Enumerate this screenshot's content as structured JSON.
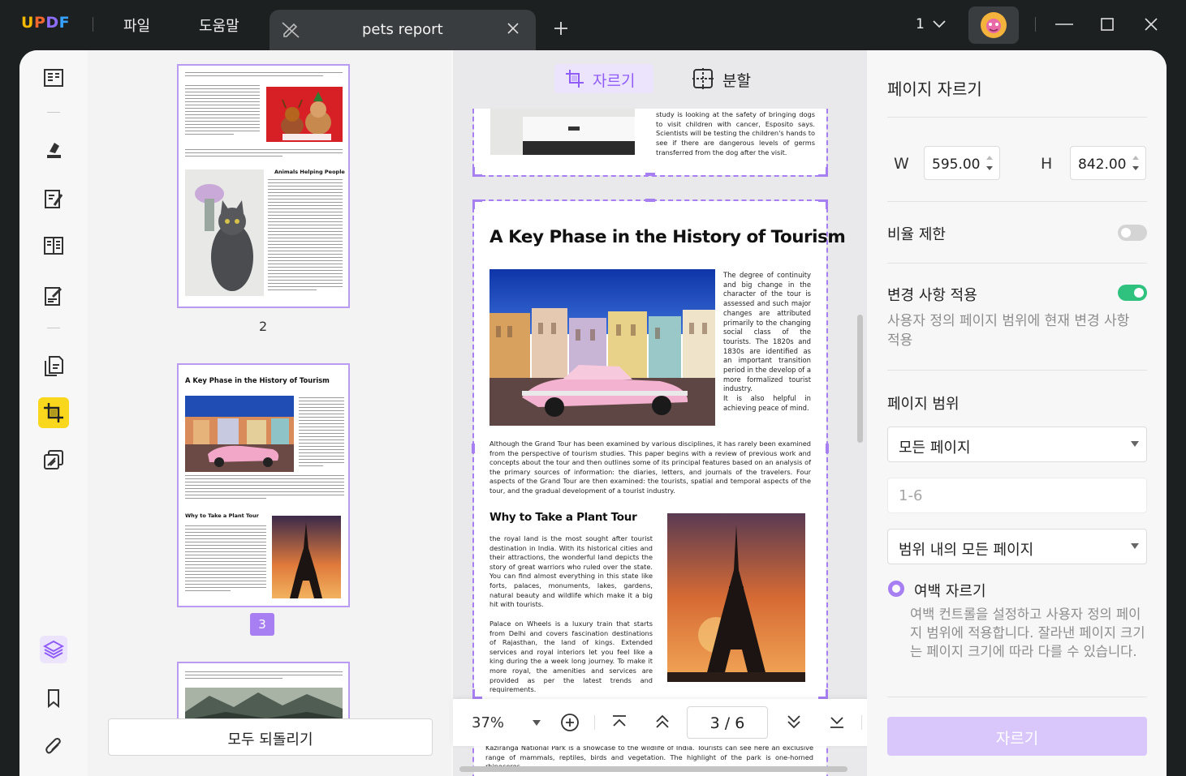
{
  "app": {
    "logo": "UPDF",
    "menu": [
      "파일",
      "도움말"
    ],
    "tab_title": "pets report",
    "page_indicator": "1",
    "brand_colors": {
      "u": "#f5b800",
      "p": "#f0662f",
      "d": "#8d6dfa",
      "f": "#36a2ff"
    }
  },
  "toolbar": {
    "crop_label": "자르기",
    "split_label": "분할"
  },
  "thumbnails": {
    "page2_number": "2",
    "page3_number": "3",
    "page2": {
      "intro": "Pet's Bodies…",
      "heading": "Animals Helping People"
    },
    "page3": {
      "title": "A Key Phase in the History of Tourism",
      "heading": "Why to Take a Plant Tour"
    },
    "page4": {
      "intro": "Kaziranga National Park is a showcase to the wildlife of India."
    },
    "revert_all_label": "모두 되돌리기"
  },
  "preview": {
    "prev_page_text": "study is looking at the safety of bringing dogs to visit children with cancer, Esposito says. Scientists will be testing the children's hands to see if there are dangerous levels of germs transferred from the dog after the visit.",
    "title": "A Key Phase in the History of Tourism",
    "side_text": "The degree of continuity and big change in the character of the tour is assessed and such major changes are attributed primarily to the changing social class of the tourists. The 1820s and 1830s are identified as an important transition period in the develop of a more formalized tourist industry.",
    "side_text2": "It is also helpful in achieving peace of mind.",
    "para1": "Although the Grand Tour has been examined by various disciplines, it has rarely been examined from the perspective of tourism studies. This paper begins with a review of previous work and concepts about the tour and then outlines some of its principal features based on an analysis of the primary sources of information: the diaries, letters, and journals of the travelers. Four aspects of the Grand Tour are then examined: the tourists, spatial and temporal aspects of the tour, and the gradual development of a tourist industry.",
    "heading2": "Why to Take a Plant Tour",
    "para2": "the royal land is the most sought after tourist destination in India. With its historical cities and their attractions, the wonderful land depicts the story of great warriors who ruled over the state. You can find almost everything in this state like forts, palaces, monuments, lakes, gardens, natural beauty and wildlife which make it a big hit with tourists.",
    "para3": "Palace on Wheels is a luxury train that starts from Delhi and covers fascination destinations of Rajasthan, the land of kings. Extended services and royal interiors let you feel like a king during the a week long journey. To make it more royal, the amenities and services are provided as per the latest trends and requirements.",
    "next_page_text": "Kaziranga National Park is a showcase to the wildlife of India. Tourists can see here an exclusive range of mammals, reptiles, birds and vegetation. The highlight of the park is one-horned rhinoceros,"
  },
  "bottombar": {
    "zoom": "37%",
    "current_page": "3",
    "separator": "/",
    "total_pages": "6"
  },
  "panel": {
    "title": "페이지 자르기",
    "w_label": "W",
    "w_value": "595.00",
    "h_label": "H",
    "h_value": "842.00",
    "ratio_label": "비율 제한",
    "ratio_on": false,
    "apply_label": "변경 사항 적용",
    "apply_on": true,
    "apply_desc": "사용자 정의 페이지 범위에 현재 변경 사항 적용",
    "range_label": "페이지 범위",
    "range_select": "모든 페이지",
    "range_placeholder": "1-6",
    "subset_select": "범위 내의 모든 페이지",
    "margin_label": "여백 자르기",
    "margin_desc": "여백 컨트롤을 설정하고 사용자 정의 페이지 범위에 적용합니다. 잘라낸 페이지 크기는 페이지 크기에 따라 다를 수 있습니다.",
    "crop_button": "자르기",
    "accent": "#8f5cf7",
    "toggle_on_color": "#2ec27e"
  }
}
